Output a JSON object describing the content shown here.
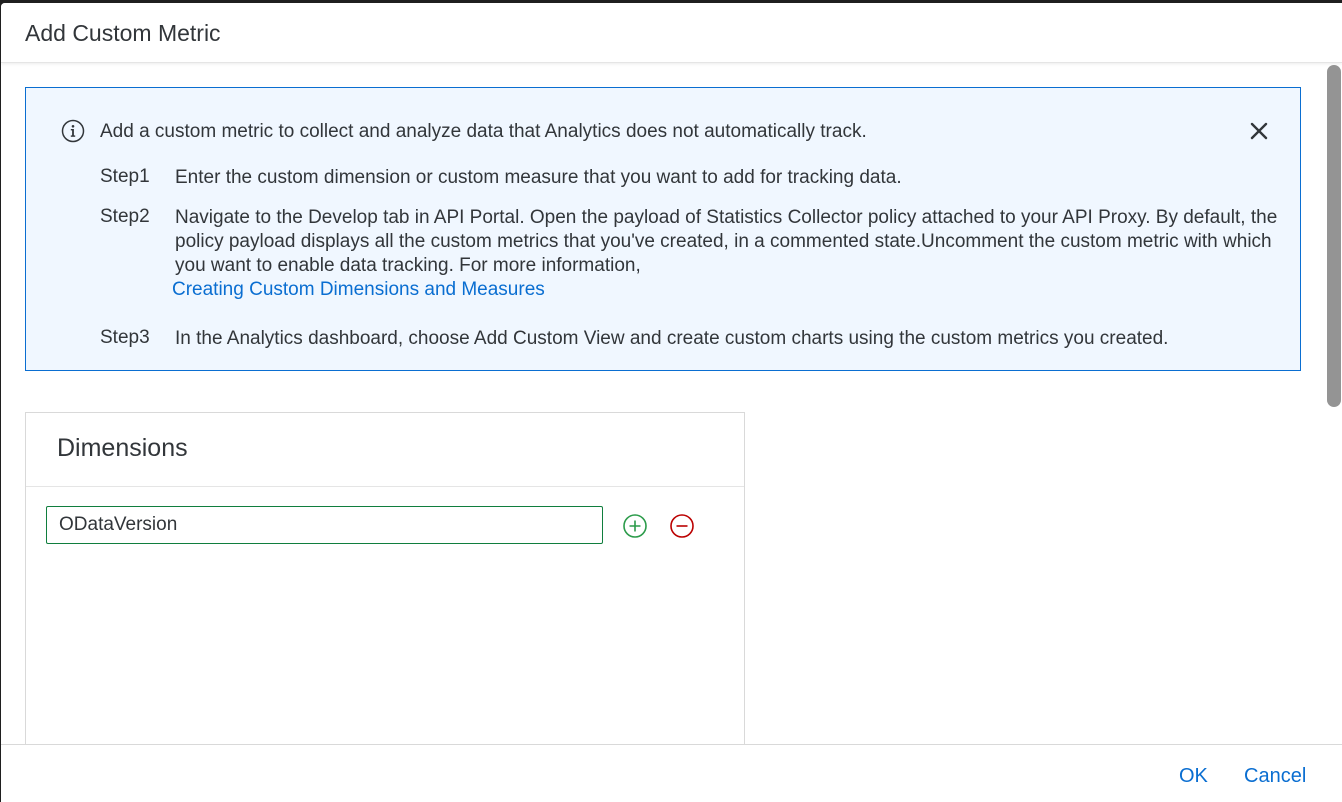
{
  "dialog": {
    "title": "Add Custom Metric"
  },
  "info": {
    "message": "Add a custom metric to collect and analyze data that Analytics does not automatically track.",
    "steps": [
      {
        "label": "Step1",
        "text": "Enter the custom dimension or custom measure that you want to add for tracking data."
      },
      {
        "label": "Step2",
        "text": "Navigate to the Develop tab in API Portal. Open the payload of Statistics Collector policy attached to your API Proxy. By default, the policy payload displays all the custom metrics that you've created, in a commented state.Uncomment the custom metric with which you want to enable data tracking. For more information,",
        "link": "Creating Custom Dimensions and Measures"
      },
      {
        "label": "Step3",
        "text": "In the Analytics dashboard, choose Add Custom View and create custom charts using the custom metrics you created."
      }
    ]
  },
  "dimensions": {
    "title": "Dimensions",
    "input_value": "ODataVersion"
  },
  "footer": {
    "ok_label": "OK",
    "cancel_label": "Cancel"
  },
  "colors": {
    "accent": "#0a6ed1",
    "add": "#107e3e",
    "remove": "#bb0000"
  },
  "icons": {
    "info": "info-icon",
    "close": "close-icon",
    "add": "add-circle-icon",
    "remove": "remove-circle-icon"
  }
}
